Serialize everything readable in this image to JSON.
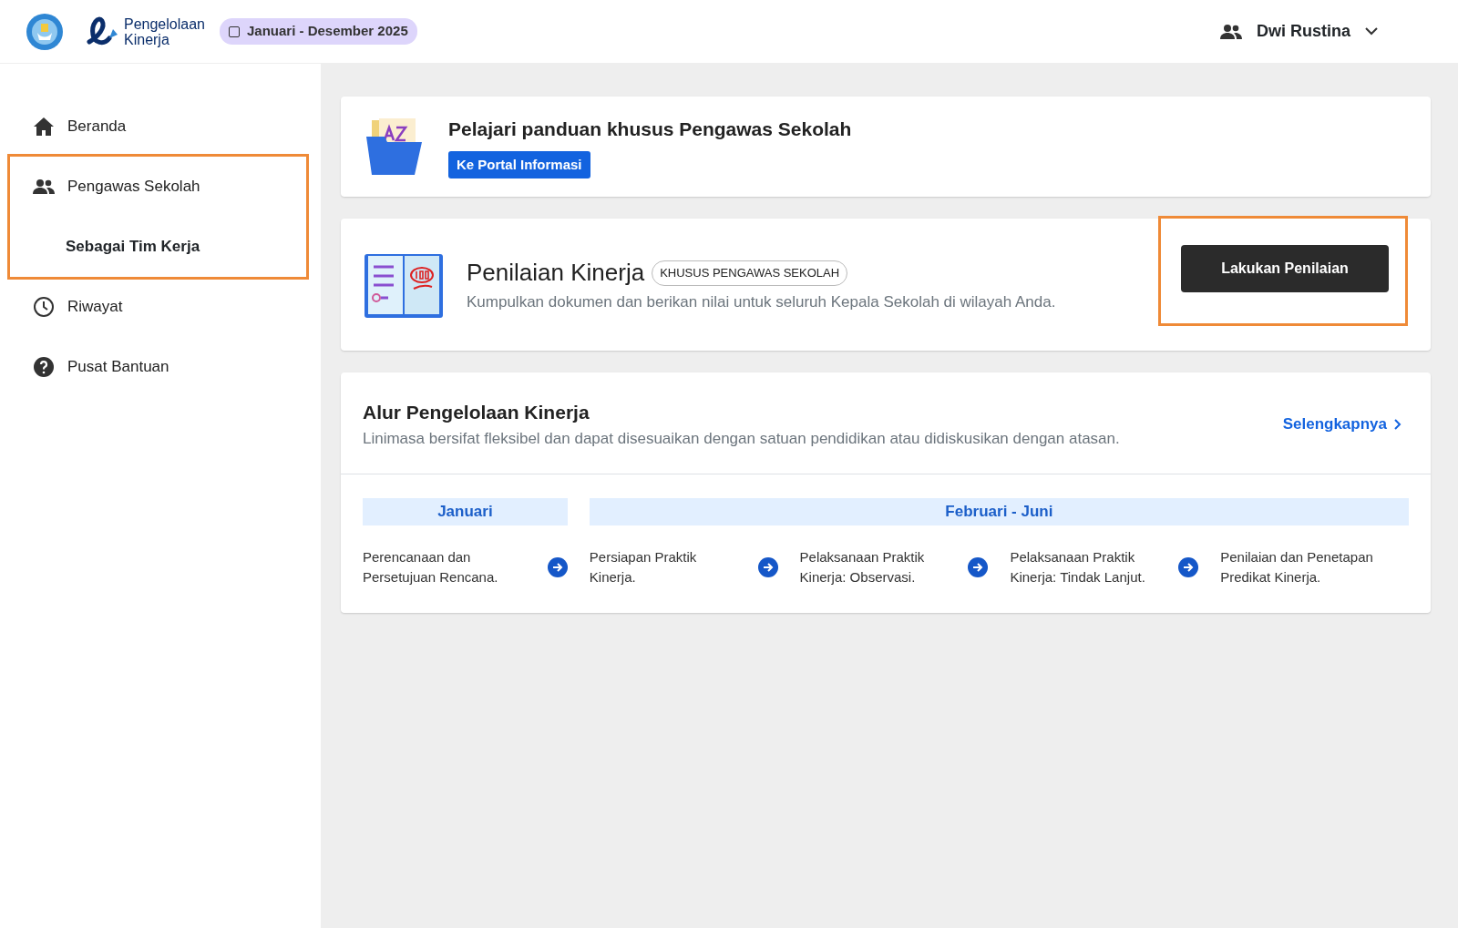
{
  "header": {
    "app_name": [
      "Pengelolaan",
      "Kinerja"
    ],
    "period": "Januari - Desember 2025",
    "user": "Dwi Rustina"
  },
  "sidebar": {
    "items": [
      {
        "label": "Beranda",
        "kind": "home",
        "selected": false,
        "highlighted": false
      },
      {
        "label": "Pengawas Sekolah",
        "kind": "people",
        "selected": false,
        "highlighted": true,
        "children": [
          {
            "label": "Sebagai Tim Kerja",
            "selected": true
          }
        ]
      },
      {
        "label": "Riwayat",
        "kind": "clock",
        "selected": false,
        "highlighted": false
      },
      {
        "label": "Pusat Bantuan",
        "kind": "help",
        "selected": false,
        "highlighted": false
      }
    ]
  },
  "guide_card": {
    "title": "Pelajari panduan khusus Pengawas Sekolah",
    "button": "Ke Portal Informasi"
  },
  "assessment_card": {
    "title": "Penilaian Kinerja",
    "tag": "KHUSUS PENGAWAS SEKOLAH",
    "description": "Kumpulkan dokumen dan berikan nilai untuk seluruh Kepala Sekolah di wilayah Anda.",
    "button": "Lakukan Penilaian",
    "highlighted": true
  },
  "flow_card": {
    "title": "Alur Pengelolaan Kinerja",
    "description": "Linimasa bersifat fleksibel dan dapat disesuaikan dengan satuan pendidikan atau didiskusikan dengan atasan.",
    "link": "Selengkapnya",
    "phases": [
      {
        "label": "Januari",
        "steps": [
          "Perencanaan dan Persetujuan Rencana."
        ]
      },
      {
        "label": "Februari - Juni",
        "steps": [
          "Persiapan Praktik Kinerja.",
          "Pelaksanaan Praktik Kinerja: Observasi.",
          "Pelaksanaan Praktik Kinerja: Tindak Lanjut.",
          "Penilaian dan Penetapan Predikat Kinerja."
        ]
      }
    ]
  }
}
